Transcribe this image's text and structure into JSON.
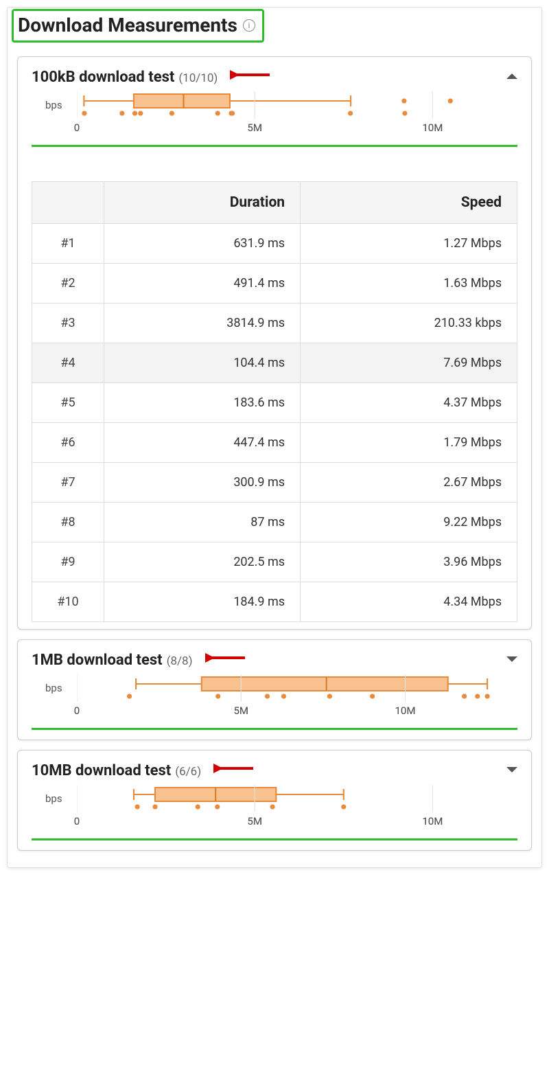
{
  "section": {
    "title": "Download Measurements"
  },
  "tests": [
    {
      "title": "100kB download test",
      "count": "(10/10)",
      "expanded": true,
      "bps_label": "bps",
      "axis_ticks": [
        "0",
        "5M",
        "10M"
      ],
      "boxplot": {
        "axis_min": 0,
        "axis_max": 12,
        "whisker_low": 0.2,
        "q1": 1.6,
        "median": 3.0,
        "q3": 4.3,
        "whisker_high": 7.7,
        "outliers": [
          9.2,
          10.5
        ],
        "points": [
          0.21,
          1.27,
          1.63,
          1.79,
          2.67,
          3.96,
          4.34,
          4.37,
          7.69,
          9.22
        ]
      },
      "table": {
        "headers": [
          "",
          "Duration",
          "Speed"
        ],
        "rows": [
          {
            "n": "#1",
            "duration": "631.9 ms",
            "speed": "1.27 Mbps"
          },
          {
            "n": "#2",
            "duration": "491.4 ms",
            "speed": "1.63 Mbps"
          },
          {
            "n": "#3",
            "duration": "3814.9 ms",
            "speed": "210.33 kbps"
          },
          {
            "n": "#4",
            "duration": "104.4 ms",
            "speed": "7.69 Mbps"
          },
          {
            "n": "#5",
            "duration": "183.6 ms",
            "speed": "4.37 Mbps"
          },
          {
            "n": "#6",
            "duration": "447.4 ms",
            "speed": "1.79 Mbps"
          },
          {
            "n": "#7",
            "duration": "300.9 ms",
            "speed": "2.67 Mbps"
          },
          {
            "n": "#8",
            "duration": "87 ms",
            "speed": "9.22 Mbps"
          },
          {
            "n": "#9",
            "duration": "202.5 ms",
            "speed": "3.96 Mbps"
          },
          {
            "n": "#10",
            "duration": "184.9 ms",
            "speed": "4.34 Mbps"
          }
        ]
      }
    },
    {
      "title": "1MB download test",
      "count": "(8/8)",
      "expanded": false,
      "bps_label": "bps",
      "axis_ticks": [
        "0",
        "5M",
        "10M"
      ],
      "boxplot": {
        "axis_min": 0,
        "axis_max": 13,
        "whisker_low": 1.8,
        "q1": 3.8,
        "median": 7.6,
        "q3": 11.3,
        "whisker_high": 12.5,
        "outliers": [],
        "points": [
          1.6,
          4.3,
          5.8,
          6.3,
          7.7,
          9.0,
          11.8,
          12.2,
          12.5
        ]
      }
    },
    {
      "title": "10MB download test",
      "count": "(6/6)",
      "expanded": false,
      "bps_label": "bps",
      "axis_ticks": [
        "0",
        "5M",
        "10M"
      ],
      "boxplot": {
        "axis_min": 0,
        "axis_max": 12,
        "whisker_low": 1.6,
        "q1": 2.2,
        "median": 3.9,
        "q3": 5.6,
        "whisker_high": 7.5,
        "outliers": [],
        "points": [
          1.7,
          2.2,
          3.4,
          3.95,
          5.5,
          7.5
        ]
      }
    }
  ],
  "chart_data": [
    {
      "type": "boxplot",
      "title": "100kB download test",
      "xlabel": "bps",
      "x_ticks": [
        0,
        5000000,
        10000000
      ],
      "whisker_low": 210000,
      "q1": 1600000,
      "median": 3000000,
      "q3": 4350000,
      "whisker_high": 7690000,
      "outliers": [
        9220000
      ],
      "points_bps": [
        210330,
        1270000,
        1630000,
        1790000,
        2670000,
        3960000,
        4340000,
        4370000,
        7690000,
        9220000
      ]
    },
    {
      "type": "boxplot",
      "title": "1MB download test",
      "xlabel": "bps",
      "x_ticks": [
        0,
        5000000,
        10000000
      ],
      "whisker_low": 1800000,
      "q1": 3800000,
      "median": 7600000,
      "q3": 11300000,
      "whisker_high": 12500000,
      "points_bps": [
        1600000,
        4300000,
        5800000,
        6300000,
        7700000,
        9000000,
        11800000,
        12200000,
        12500000
      ]
    },
    {
      "type": "boxplot",
      "title": "10MB download test",
      "xlabel": "bps",
      "x_ticks": [
        0,
        5000000,
        10000000
      ],
      "whisker_low": 1600000,
      "q1": 2200000,
      "median": 3900000,
      "q3": 5600000,
      "whisker_high": 7500000,
      "points_bps": [
        1700000,
        2200000,
        3400000,
        3950000,
        5500000,
        7500000
      ]
    }
  ]
}
